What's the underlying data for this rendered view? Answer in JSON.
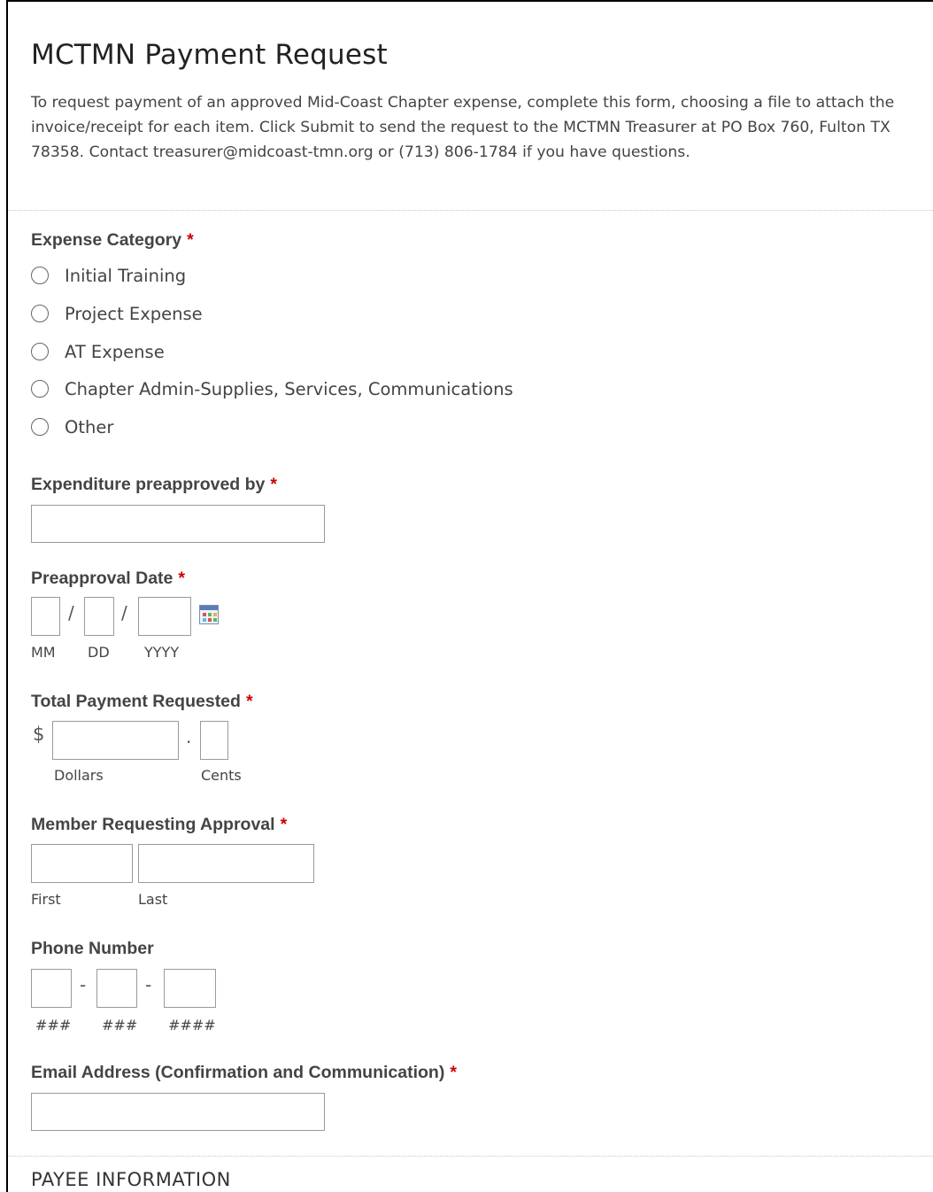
{
  "form": {
    "title": "MCTMN Payment Request",
    "intro": "To request payment of an approved Mid-Coast Chapter expense, complete this form, choosing a file to attach the invoice/receipt for each item. Click Submit to send the request to the MCTMN Treasurer at PO Box 760, Fulton TX 78358. Contact treasurer@midcoast-tmn.org or (713) 806-1784 if you have questions.",
    "required_mark": "*"
  },
  "expense_category": {
    "label": "Expense Category",
    "options": [
      "Initial Training",
      "Project Expense",
      "AT Expense",
      "Chapter Admin-Supplies, Services, Communications",
      "Other"
    ]
  },
  "preapproved_by": {
    "label": "Expenditure preapproved by",
    "value": ""
  },
  "preapproval_date": {
    "label": "Preapproval Date",
    "separator": "/",
    "sub_month": "MM",
    "sub_day": "DD",
    "sub_year": "YYYY",
    "icon": "calendar-icon"
  },
  "total_payment": {
    "label": "Total Payment Requested",
    "currency": "$",
    "decimal": ".",
    "sub_dollars": "Dollars",
    "sub_cents": "Cents"
  },
  "member": {
    "label": "Member Requesting Approval",
    "sub_first": "First",
    "sub_last": "Last"
  },
  "phone": {
    "label": "Phone Number",
    "separator": "-",
    "sub_area": "###",
    "sub_prefix": "###",
    "sub_line": "####"
  },
  "email": {
    "label": "Email Address (Confirmation and Communication)",
    "value": ""
  },
  "next_section": "PAYEE INFORMATION"
}
